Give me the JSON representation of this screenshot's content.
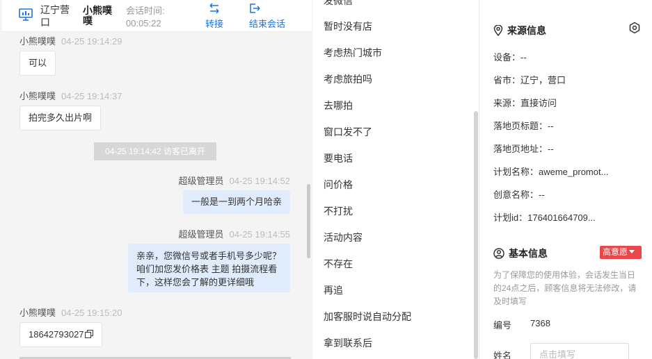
{
  "header": {
    "location": "辽宁营口",
    "visitor_name": "小熊噗噗",
    "time_label": "会话时间:",
    "time_value": "00:05:22",
    "transfer_label": "转接",
    "end_label": "结束会话"
  },
  "messages": [
    {
      "sender": "小熊噗噗",
      "time": "04-25 19:14:29",
      "text": "可以"
    },
    {
      "sender": "小熊噗噗",
      "time": "04-25 19:14:37",
      "text": "拍完多久出片啊"
    },
    {
      "system": "04-25 19:14:42 访客已离开"
    },
    {
      "sender": "超级管理员",
      "time": "04-25 19:14:52",
      "text": "一般是一到两个月哈亲"
    },
    {
      "sender": "超级管理员",
      "time": "04-25 19:14:55",
      "text": "亲亲，您微信号或者手机号多少呢？咱们加您发价格表 主题 拍摄流程看下，这样您会了解的更详细哦"
    },
    {
      "sender": "小熊噗噗",
      "time": "04-25 19:15:20",
      "text": "18642793027"
    }
  ],
  "quick_replies": [
    "发微信",
    "暂时没有店",
    "考虑热门城市",
    "考虑旅拍吗",
    "去哪拍",
    "窗口发不了",
    "要电话",
    "问价格",
    "不打扰",
    "活动内容",
    "不存在",
    "再追",
    "加客服时说自动分配",
    "拿到联系后"
  ],
  "source_info": {
    "title": "来源信息",
    "rows": [
      "设备：--",
      "省市：辽宁，营口",
      "来源：直接访问",
      "落地页标题：--",
      "落地页地址：--",
      "计划名称：aweme_promot...",
      "创意名称：--",
      "计划id：176401664709..."
    ]
  },
  "basic_info": {
    "title": "基本信息",
    "intent": "高意愿",
    "notice": "为了保障您的使用体验，会话发生当日的24点之后，顾客信息将无法修改，请及时填写",
    "id_label": "编号",
    "id_value": "7368",
    "name_label": "姓名",
    "name_placeholder": "点击填写"
  },
  "colors": {
    "accent": "#1a73e8",
    "agent_bubble": "#e0ecfc",
    "badge": "#e8474b"
  }
}
